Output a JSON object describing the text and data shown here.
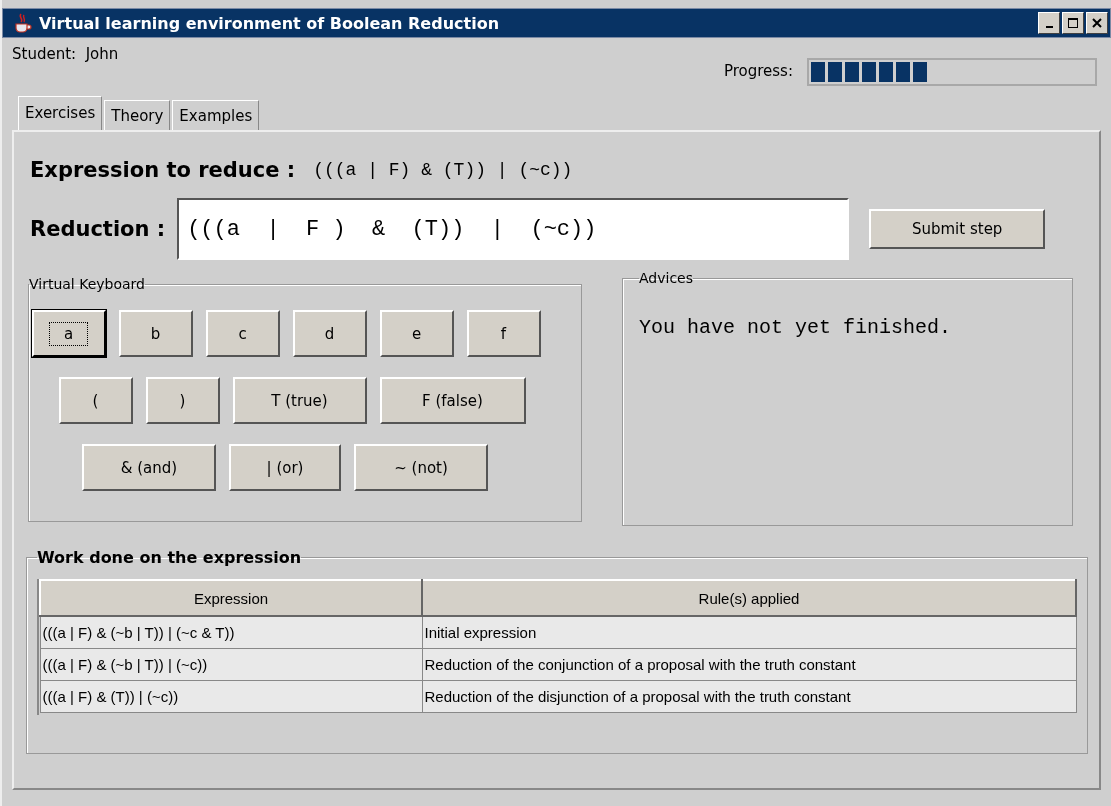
{
  "window": {
    "title": "Virtual learning environment of Boolean Reduction"
  },
  "student": {
    "label": "Student:",
    "name": "John"
  },
  "progress": {
    "label": "Progress:",
    "level": 0.42
  },
  "tabs": [
    {
      "label": "Exercises",
      "selected": true
    },
    {
      "label": "Theory",
      "selected": false
    },
    {
      "label": "Examples",
      "selected": false
    }
  ],
  "expression": {
    "label": "Expression to reduce :",
    "value": "(((a | F) & (T)) | (~c))"
  },
  "reduction": {
    "label": "Reduction :",
    "value": "(((a  |  F )  &  (T))  |  (~c))"
  },
  "submit_button": "Submit step",
  "keyboard": {
    "title": "Virtual Keyboard",
    "letter_keys": [
      {
        "label": "a",
        "focused": true
      },
      {
        "label": "b",
        "focused": false
      },
      {
        "label": "c",
        "focused": false
      },
      {
        "label": "d",
        "focused": false
      },
      {
        "label": "e",
        "focused": false
      },
      {
        "label": "f",
        "focused": false
      }
    ],
    "constant_keys": [
      {
        "label": "(",
        "focused": false
      },
      {
        "label": ")",
        "focused": false
      },
      {
        "label": "T (true)",
        "focused": false
      },
      {
        "label": "F (false)",
        "focused": false
      }
    ],
    "operator_keys": [
      {
        "label": "& (and)",
        "focused": false
      },
      {
        "label": "| (or)",
        "focused": false
      },
      {
        "label": "~ (not)",
        "focused": false
      }
    ]
  },
  "advices": {
    "title": "Advices",
    "text": "You have not yet finished."
  },
  "work": {
    "title": "Work done on the expression",
    "columns": [
      "Expression",
      "Rule(s) applied"
    ],
    "rows": [
      [
        "(((a | F) & (~b | T)) | (~c & T))",
        "Initial expression"
      ],
      [
        "(((a | F) & (~b | T)) | (~c))",
        "Reduction of the conjunction of a proposal with the truth constant"
      ],
      [
        "(((a | F) & (T)) | (~c))",
        "Reduction of the disjunction of a proposal with the truth constant"
      ]
    ]
  }
}
